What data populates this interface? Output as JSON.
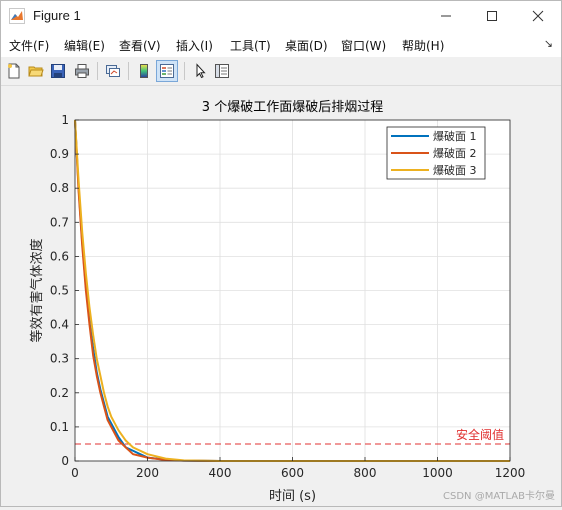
{
  "window": {
    "title": "Figure 1"
  },
  "menu": [
    "文件(F)",
    "编辑(E)",
    "查看(V)",
    "插入(I)",
    "工具(T)",
    "桌面(D)",
    "窗口(W)",
    "帮助(H)"
  ],
  "toolbar": [
    "new-figure",
    "open-file",
    "save",
    "print",
    "link-plot",
    "insert-colorbar",
    "insert-legend",
    "edit-plot",
    "property-inspector"
  ],
  "chart_data": {
    "type": "line",
    "title": "3 个爆破工作面爆破后排烟过程",
    "xlabel": "时间 (s)",
    "ylabel": "等效有害气体浓度",
    "xlim": [
      0,
      1200
    ],
    "ylim": [
      0,
      1
    ],
    "xticks": [
      "0",
      "200",
      "400",
      "600",
      "800",
      "1000",
      "1200"
    ],
    "yticks": [
      "0",
      "0.1",
      "0.2",
      "0.3",
      "0.4",
      "0.5",
      "0.6",
      "0.7",
      "0.8",
      "0.9",
      "1"
    ],
    "grid": true,
    "legend_position": "top-right",
    "series": [
      {
        "name": "爆破面 1",
        "color": "#0072BD",
        "x": [
          0,
          10,
          20,
          30,
          40,
          50,
          60,
          70,
          80,
          90,
          100,
          120,
          140,
          160,
          180,
          200,
          250,
          300,
          400,
          600,
          800,
          1000,
          1200
        ],
        "y": [
          1,
          0.8,
          0.64,
          0.51,
          0.41,
          0.33,
          0.26,
          0.21,
          0.17,
          0.13,
          0.11,
          0.07,
          0.04,
          0.03,
          0.02,
          0.01,
          0.004,
          0.001,
          0,
          0,
          0,
          0,
          0
        ]
      },
      {
        "name": "爆破面 2",
        "color": "#D95319",
        "x": [
          0,
          10,
          20,
          30,
          40,
          50,
          60,
          70,
          80,
          90,
          100,
          120,
          140,
          160,
          180,
          200,
          250,
          300,
          400,
          600,
          800,
          1000,
          1200
        ],
        "y": [
          1,
          0.79,
          0.63,
          0.5,
          0.4,
          0.31,
          0.25,
          0.2,
          0.16,
          0.12,
          0.1,
          0.06,
          0.04,
          0.02,
          0.015,
          0.01,
          0.003,
          0.001,
          0,
          0,
          0,
          0,
          0
        ]
      },
      {
        "name": "爆破面 3",
        "color": "#EDB120",
        "x": [
          0,
          10,
          20,
          30,
          40,
          50,
          60,
          70,
          80,
          90,
          100,
          120,
          140,
          160,
          180,
          200,
          250,
          300,
          400,
          600,
          800,
          1000,
          1200
        ],
        "y": [
          1,
          0.82,
          0.67,
          0.55,
          0.45,
          0.37,
          0.3,
          0.25,
          0.2,
          0.16,
          0.13,
          0.09,
          0.06,
          0.04,
          0.03,
          0.02,
          0.007,
          0.002,
          0,
          0,
          0,
          0,
          0
        ]
      }
    ],
    "threshold": {
      "label": "安全阈值",
      "value": 0.05,
      "color": "#e03030"
    }
  },
  "watermark": "CSDN @MATLAB卡尔曼"
}
